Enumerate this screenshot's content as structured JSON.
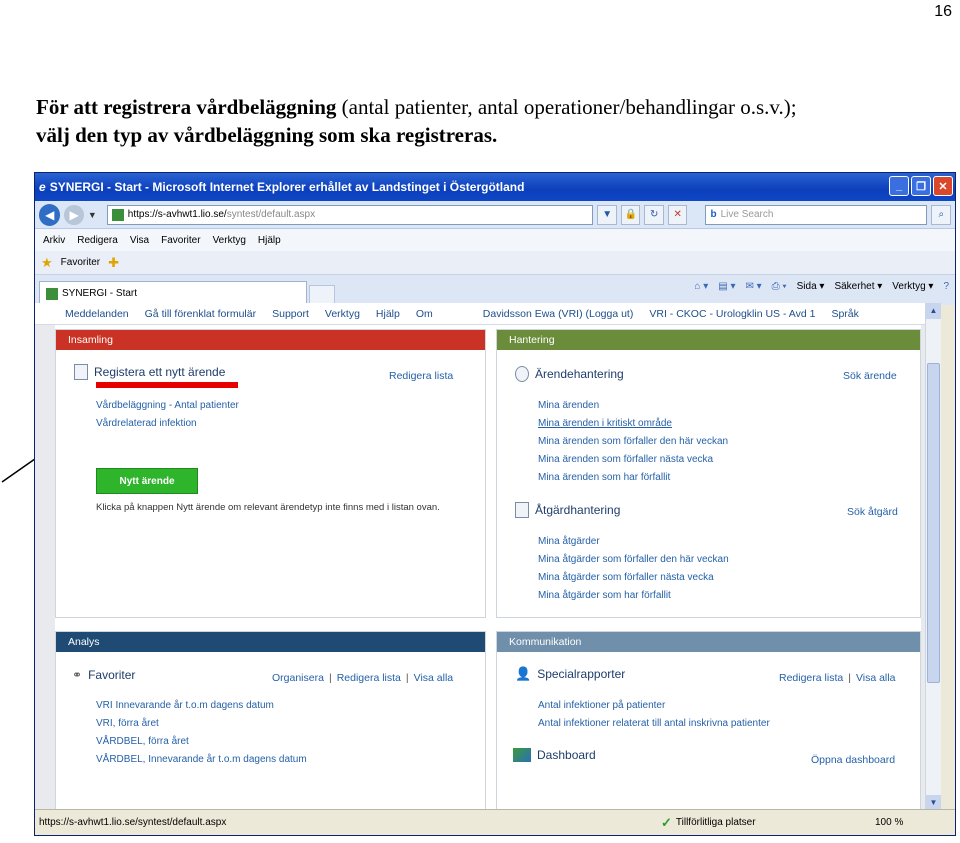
{
  "page_number": "16",
  "instruction": {
    "bold_lead": "För att registrera vårdbeläggning",
    "normal_part": " (antal patienter, antal operationer/behandlingar o.s.v.);",
    "bold_second_line": "välj den typ av vårdbeläggning som ska registreras."
  },
  "window": {
    "title": "SYNERGI - Start - Microsoft Internet Explorer erhållet av Landstinget i Östergötland",
    "url_host": "https://s-avhwt1.lio.se/",
    "url_path": "syntest/default.aspx",
    "search_placeholder": "Live Search",
    "menu": [
      "Arkiv",
      "Redigera",
      "Visa",
      "Favoriter",
      "Verktyg",
      "Hjälp"
    ],
    "favorites_label": "Favoriter",
    "tab_label": "SYNERGI - Start",
    "cmd": {
      "page": "Sida ▾",
      "safety": "Säkerhet ▾",
      "tools": "Verktyg ▾",
      "help": "?"
    },
    "status_url": "https://s-avhwt1.lio.se/syntest/default.aspx",
    "status_trusted": "Tillförlitliga platser",
    "status_zoom": "100 %"
  },
  "topnav": {
    "items": [
      "Meddelanden",
      "Gå till förenklat formulär",
      "Support",
      "Verktyg",
      "Hjälp",
      "Om"
    ],
    "user": "Davidsson Ewa (VRI) (Logga ut)",
    "unit": "VRI - CKOC - Urologklin US - Avd 1",
    "language": "Språk"
  },
  "insamling": {
    "header": "Insamling",
    "section_title": "Registera ett nytt ärende",
    "edit_list": "Redigera lista",
    "links": [
      "Vårdbeläggning - Antal patienter",
      "Vårdrelaterad infektion"
    ],
    "new_button": "Nytt ärende",
    "hint": "Klicka på knappen Nytt ärende om relevant ärendetyp inte finns med i listan ovan."
  },
  "hantering": {
    "header": "Hantering",
    "case_title": "Ärendehantering",
    "case_search": "Sök ärende",
    "case_links": [
      "Mina ärenden",
      "Mina ärenden i kritiskt område",
      "Mina ärenden som förfaller den här veckan",
      "Mina ärenden som förfaller nästa vecka",
      "Mina ärenden som har förfallit"
    ],
    "action_title": "Åtgärdhantering",
    "action_search": "Sök åtgärd",
    "action_links": [
      "Mina åtgärder",
      "Mina åtgärder som förfaller den här veckan",
      "Mina åtgärder som förfaller nästa vecka",
      "Mina åtgärder som har förfallit"
    ]
  },
  "analys": {
    "header": "Analys",
    "fav_title": "Favoriter",
    "organize": "Organisera",
    "edit_list": "Redigera lista",
    "show_all": "Visa alla",
    "links": [
      "VRI Innevarande år t.o.m dagens datum",
      "VRI, förra året",
      "VÅRDBEL, förra året",
      "VÅRDBEL, Innevarande år t.o.m dagens datum"
    ]
  },
  "kommunikation": {
    "header": "Kommunikation",
    "special_title": "Specialrapporter",
    "edit_list": "Redigera lista",
    "show_all": "Visa alla",
    "special_links": [
      "Antal infektioner på patienter",
      "Antal infektioner relaterat till antal inskrivna patienter"
    ],
    "dashboard_title": "Dashboard",
    "open_dashboard": "Öppna dashboard"
  }
}
